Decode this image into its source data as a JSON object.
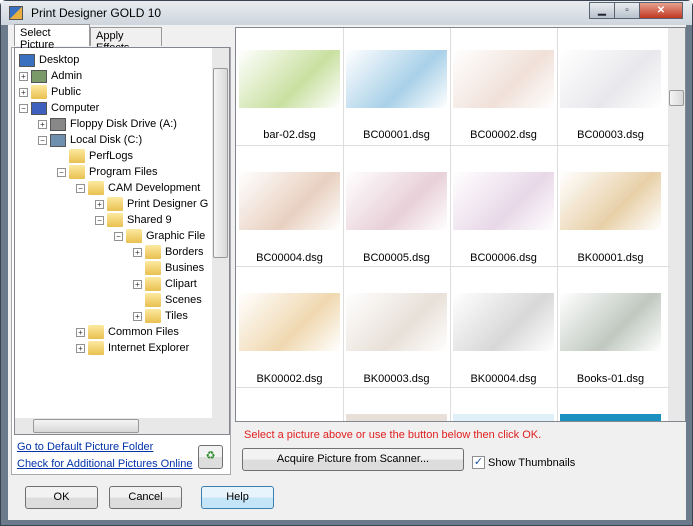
{
  "window": {
    "title": "Print Designer GOLD 10"
  },
  "tabs": [
    {
      "label": "Select Picture"
    },
    {
      "label": "Apply Effects"
    }
  ],
  "tree": [
    {
      "label": "Desktop",
      "level": 0,
      "toggle": "",
      "icon": "desktop"
    },
    {
      "label": "Admin",
      "level": 1,
      "toggle": "+",
      "icon": "user"
    },
    {
      "label": "Public",
      "level": 1,
      "toggle": "+",
      "icon": "folder"
    },
    {
      "label": "Computer",
      "level": 1,
      "toggle": "-",
      "icon": "computer"
    },
    {
      "label": "Floppy Disk Drive (A:)",
      "level": 2,
      "toggle": "+",
      "icon": "floppy"
    },
    {
      "label": "Local Disk (C:)",
      "level": 2,
      "toggle": "-",
      "icon": "disk"
    },
    {
      "label": "PerfLogs",
      "level": 3,
      "toggle": "",
      "icon": "folder"
    },
    {
      "label": "Program Files",
      "level": 3,
      "toggle": "-",
      "icon": "folder"
    },
    {
      "label": "CAM Development",
      "level": 4,
      "toggle": "-",
      "icon": "folder"
    },
    {
      "label": "Print Designer G",
      "level": 5,
      "toggle": "+",
      "icon": "folder"
    },
    {
      "label": "Shared 9",
      "level": 5,
      "toggle": "-",
      "icon": "folder"
    },
    {
      "label": "Graphic File",
      "level": 6,
      "toggle": "-",
      "icon": "folder"
    },
    {
      "label": "Borders",
      "level": 7,
      "toggle": "+",
      "icon": "folder"
    },
    {
      "label": "Busines",
      "level": 7,
      "toggle": "",
      "icon": "folder"
    },
    {
      "label": "Clipart",
      "level": 7,
      "toggle": "+",
      "icon": "folder"
    },
    {
      "label": "Scenes",
      "level": 7,
      "toggle": "",
      "icon": "folder"
    },
    {
      "label": "Tiles",
      "level": 7,
      "toggle": "+",
      "icon": "folder"
    },
    {
      "label": "Common Files",
      "level": 4,
      "toggle": "+",
      "icon": "folder"
    },
    {
      "label": "Internet Explorer",
      "level": 4,
      "toggle": "+",
      "icon": "folder"
    }
  ],
  "links": {
    "default_folder": "Go to Default Picture Folder",
    "check_online": "Check for Additional Pictures Online"
  },
  "thumbnails": [
    {
      "name": "bar-02.dsg",
      "color": "#c8e0a0"
    },
    {
      "name": "BC00001.dsg",
      "color": "#a8d0e8"
    },
    {
      "name": "BC00002.dsg",
      "color": "#f0e0d8"
    },
    {
      "name": "BC00003.dsg",
      "color": "#e8e8ec"
    },
    {
      "name": "BC00004.dsg",
      "color": "#e8d0c0"
    },
    {
      "name": "BC00005.dsg",
      "color": "#e8d0d8"
    },
    {
      "name": "BC00006.dsg",
      "color": "#e8d8e8"
    },
    {
      "name": "BK00001.dsg",
      "color": "#e8d0a8"
    },
    {
      "name": "BK00002.dsg",
      "color": "#f0d8b0"
    },
    {
      "name": "BK00003.dsg",
      "color": "#e8e0d8"
    },
    {
      "name": "BK00004.dsg",
      "color": "#d8d8d8"
    },
    {
      "name": "Books-01.dsg",
      "color": "#c0c8c0"
    }
  ],
  "status": "Select a picture above or use  the button below then click OK.",
  "scanner_button": "Acquire Picture from Scanner...",
  "show_thumbnails": {
    "label": "Show Thumbnails",
    "checked": true
  },
  "buttons": {
    "ok": "OK",
    "cancel": "Cancel",
    "help": "Help"
  }
}
